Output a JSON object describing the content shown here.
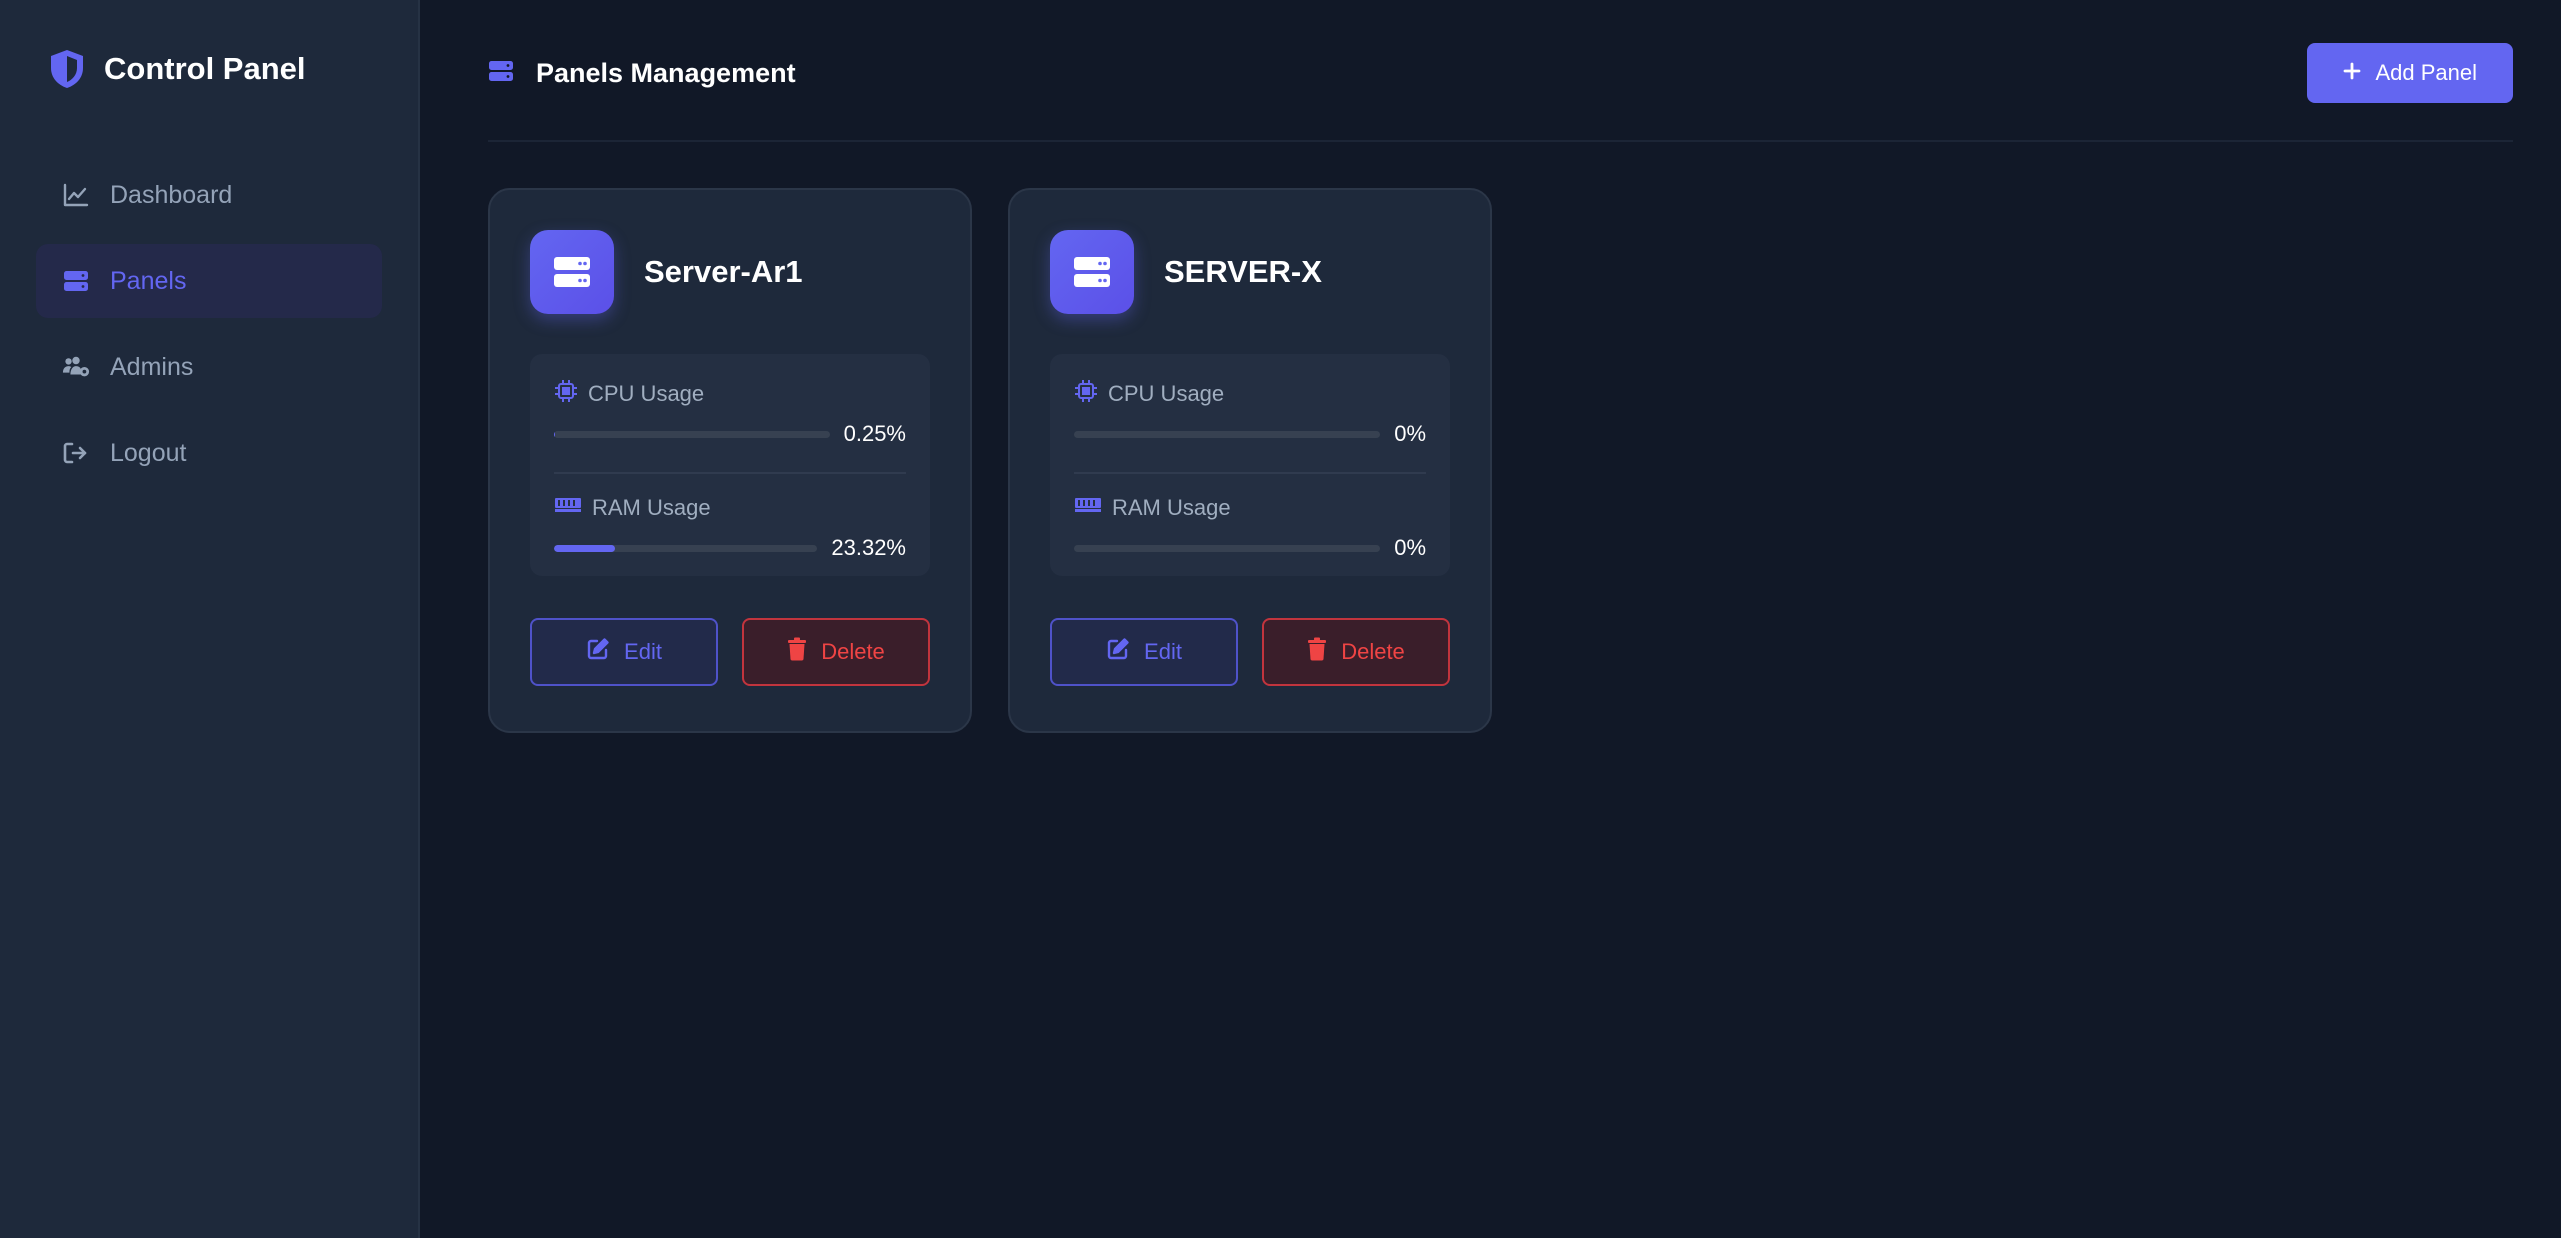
{
  "sidebar": {
    "brand": {
      "title": "Control Panel",
      "icon": "shield-icon"
    },
    "items": [
      {
        "label": "Dashboard",
        "icon": "chart-line-icon"
      },
      {
        "label": "Panels",
        "icon": "server-icon",
        "active": true
      },
      {
        "label": "Admins",
        "icon": "users-cog-icon"
      },
      {
        "label": "Logout",
        "icon": "logout-icon"
      }
    ]
  },
  "header": {
    "title": "Panels Management",
    "add_button_label": "Add Panel"
  },
  "panels": [
    {
      "name": "Server-Ar1",
      "cpu_label": "CPU Usage",
      "cpu_value": "0.25%",
      "cpu_fraction": 0.0025,
      "ram_label": "RAM Usage",
      "ram_value": "23.32%",
      "ram_fraction": 0.2332,
      "edit_label": "Edit",
      "delete_label": "Delete"
    },
    {
      "name": "SERVER-X",
      "cpu_label": "CPU Usage",
      "cpu_value": "0%",
      "cpu_fraction": 0,
      "ram_label": "RAM Usage",
      "ram_value": "0%",
      "ram_fraction": 0,
      "edit_label": "Edit",
      "delete_label": "Delete"
    }
  ],
  "colors": {
    "accent": "#6366f1",
    "danger": "#ef4444",
    "background": "#111827",
    "sidebar": "#1e293b"
  }
}
